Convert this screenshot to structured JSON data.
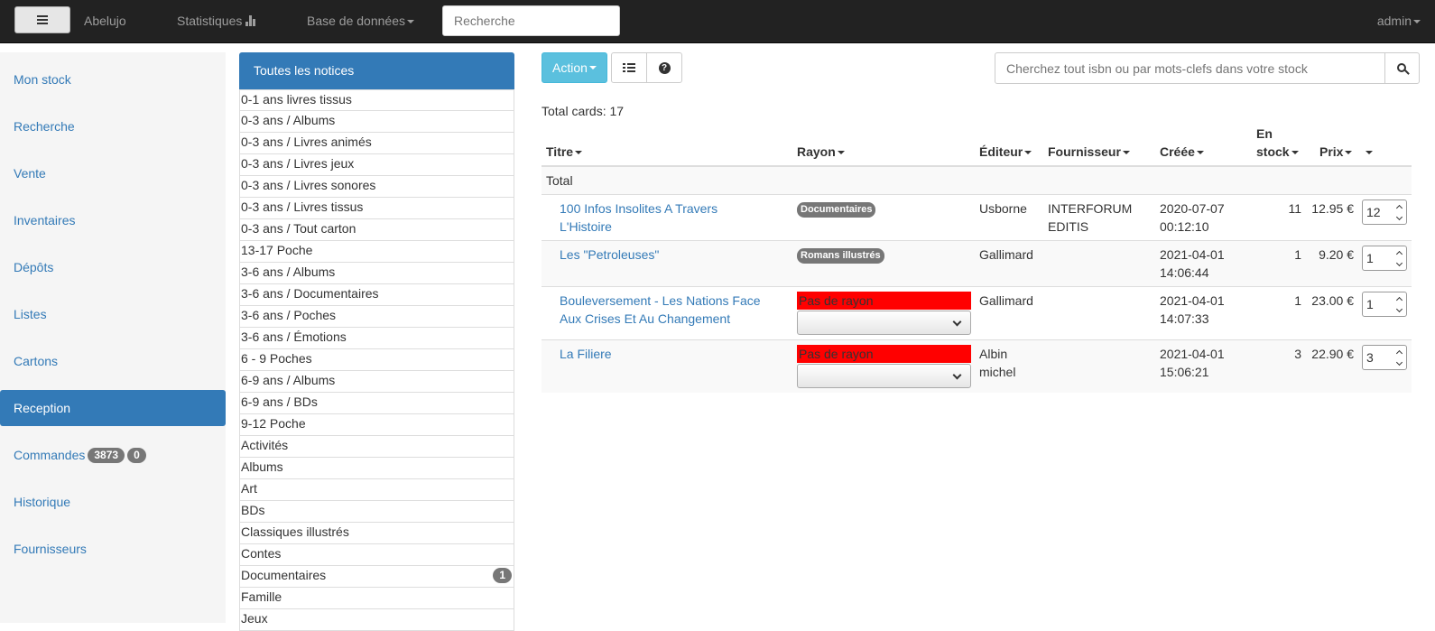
{
  "navbar": {
    "brand": "Abelujo",
    "stats_label": "Statistiques",
    "db_label": "Base de données",
    "search_placeholder": "Recherche",
    "user": "admin"
  },
  "sidebar": {
    "items": [
      {
        "label": "Mon stock"
      },
      {
        "label": "Recherche"
      },
      {
        "label": "Vente"
      },
      {
        "label": "Inventaires"
      },
      {
        "label": "Dépôts"
      },
      {
        "label": "Listes"
      },
      {
        "label": "Cartons"
      },
      {
        "label": "Reception",
        "active": true
      },
      {
        "label": "Commandes",
        "badge1": "3873",
        "badge2": "0"
      },
      {
        "label": "Historique"
      },
      {
        "label": "Fournisseurs"
      }
    ]
  },
  "shelves": {
    "header": "Toutes les notices",
    "items": [
      {
        "label": "0-1 ans livres tissus"
      },
      {
        "label": "0-3 ans / Albums"
      },
      {
        "label": "0-3 ans / Livres animés"
      },
      {
        "label": "0-3 ans / Livres jeux"
      },
      {
        "label": "0-3 ans / Livres sonores"
      },
      {
        "label": "0-3 ans / Livres tissus"
      },
      {
        "label": "0-3 ans / Tout carton"
      },
      {
        "label": "13-17 Poche"
      },
      {
        "label": "3-6 ans / Albums"
      },
      {
        "label": "3-6 ans / Documentaires"
      },
      {
        "label": "3-6 ans / Poches"
      },
      {
        "label": "3-6 ans / Émotions"
      },
      {
        "label": "6 - 9 Poches"
      },
      {
        "label": "6-9 ans / Albums"
      },
      {
        "label": "6-9 ans / BDs"
      },
      {
        "label": "9-12 Poche"
      },
      {
        "label": "Activités"
      },
      {
        "label": "Albums"
      },
      {
        "label": "Art"
      },
      {
        "label": "BDs"
      },
      {
        "label": "Classiques illustrés"
      },
      {
        "label": "Contes"
      },
      {
        "label": "Documentaires",
        "count": "1"
      },
      {
        "label": "Famille"
      },
      {
        "label": "Jeux"
      }
    ]
  },
  "toolbar": {
    "action_label": "Action",
    "stock_search_placeholder": "Cherchez tout isbn ou par mots-clefs dans votre stock"
  },
  "summary": {
    "total_cards": "Total cards: 17"
  },
  "table": {
    "headers": {
      "title": "Titre",
      "shelf": "Rayon",
      "publisher": "Éditeur",
      "supplier": "Fournisseur",
      "created": "Créée",
      "stock_line1": "En",
      "stock_line2": "stock",
      "price": "Prix"
    },
    "total_label": "Total",
    "rows": [
      {
        "title_line1": "100 Infos Insolites A Travers",
        "title_line2": "L'Histoire",
        "shelf": "Documentaires",
        "publisher_line1": "Usborne",
        "publisher_line2": "",
        "supplier_line1": "INTERFORUM",
        "supplier_line2": "EDITIS",
        "date": "2020-07-07",
        "time": "00:12:10",
        "stock": "11",
        "price": "12.95 €",
        "qty": "12"
      },
      {
        "title_line1": "Les \"Petroleuses\"",
        "title_line2": "",
        "shelf": "Romans illustrés",
        "publisher_line1": "Gallimard",
        "publisher_line2": "",
        "supplier_line1": "",
        "supplier_line2": "",
        "date": "2021-04-01",
        "time": "14:06:44",
        "stock": "1",
        "price": "9.20 €",
        "qty": "1"
      },
      {
        "title_line1": "Bouleversement - Les Nations Face",
        "title_line2": "Aux Crises Et Au Changement",
        "shelf_missing": "Pas de rayon",
        "publisher_line1": "Gallimard",
        "publisher_line2": "",
        "supplier_line1": "",
        "supplier_line2": "",
        "date": "2021-04-01",
        "time": "14:07:33",
        "stock": "1",
        "price": "23.00 €",
        "qty": "1"
      },
      {
        "title_line1": "La Filiere",
        "title_line2": "",
        "shelf_missing": "Pas de rayon",
        "publisher_line1": "Albin",
        "publisher_line2": "michel",
        "supplier_line1": "",
        "supplier_line2": "",
        "date": "2021-04-01",
        "time": "15:06:21",
        "stock": "3",
        "price": "22.90 €",
        "qty": "3"
      }
    ]
  },
  "colors": {
    "navbar_bg": "#222222",
    "primary": "#337ab7",
    "info_button": "#5bc0de",
    "missing_shelf": "#ff0000",
    "badge": "#777777"
  },
  "icons": {
    "menu": "hamburger-icon",
    "stats": "bar-chart-icon",
    "list": "list-icon",
    "help": "question-circle-icon",
    "search": "search-icon"
  }
}
